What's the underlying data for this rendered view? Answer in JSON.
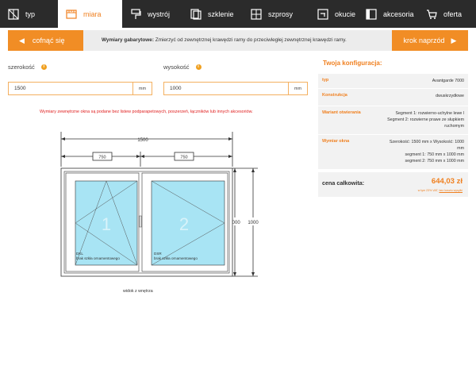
{
  "nav": {
    "tabs": [
      {
        "label": "typ",
        "icon": "window-type-icon",
        "active": false
      },
      {
        "label": "miara",
        "icon": "measure-icon",
        "active": true
      },
      {
        "label": "wystrój",
        "icon": "paint-roller-icon",
        "active": false
      },
      {
        "label": "szklenie",
        "icon": "glazing-icon",
        "active": false
      },
      {
        "label": "szprosy",
        "icon": "muntins-icon",
        "active": false
      },
      {
        "label": "okucie",
        "icon": "hardware-icon",
        "active": false
      },
      {
        "label": "akcesoria",
        "icon": "accessories-icon",
        "active": false
      },
      {
        "label": "oferta",
        "icon": "cart-icon",
        "active": false
      }
    ]
  },
  "actions": {
    "back_label": "cofnąć się",
    "next_label": "krok naprzód",
    "info_title": "Wymiary gabarytowe:",
    "info_text": "Zmierzyć od zewnętrznej krawędzi ramy do przeciwległej zewnętrznej krawędzi ramy."
  },
  "fields": {
    "width": {
      "label": "szerokość",
      "value": "1500",
      "unit": "mm"
    },
    "height": {
      "label": "wysokość",
      "value": "1000",
      "unit": "mm"
    }
  },
  "warning": "Wymiary zewnętrzne okna są podane bez listew podparapetowych, poszerzeń, łączników lub innych akcesoriów.",
  "drawing": {
    "total_width": "1500",
    "sash_left_width": "750",
    "sash_right_width": "750",
    "height_a": "1000",
    "height_b": "1000",
    "left_sash_code": "DKL",
    "right_sash_code": "DSR",
    "left_sash_note": "brak szkła ornamentowego",
    "right_sash_note": "brak szkła ornamentowego",
    "view_label": "widok z wnętrza",
    "colors": {
      "glass": "#a8e4f4",
      "frame": "#ffffff",
      "line": "#333333"
    }
  },
  "config": {
    "title": "Twoja konfiguracja:",
    "rows": [
      {
        "key": "typ",
        "value": [
          "Avantgarde 7000"
        ]
      },
      {
        "key": "Konstrukcja",
        "value": [
          "dwuskrzydłowe"
        ]
      },
      {
        "key": "Wariant otwierania",
        "value": [
          "Segment 1: rozwierno-uchylne lewe l",
          "Segment 2: rozwierne prawe ze słupkiem",
          "ruchomym"
        ]
      },
      {
        "key": "Wymiar okna",
        "value": [
          "Szerokość: 1500 mm x Wysokość: 1000",
          "mm",
          "segment 1: 750 mm x 1000 mm",
          "segment 2: 750 mm x 1000 mm"
        ]
      }
    ],
    "price_label": "cena całkowita:",
    "price_value": "644,03 zł",
    "price_note_prefix": "w tym 23% VAT, ",
    "price_note_link": "bez kosztu wysyłki"
  },
  "accent_color": "#f18d25",
  "nav_bg": "#2b2b2b"
}
